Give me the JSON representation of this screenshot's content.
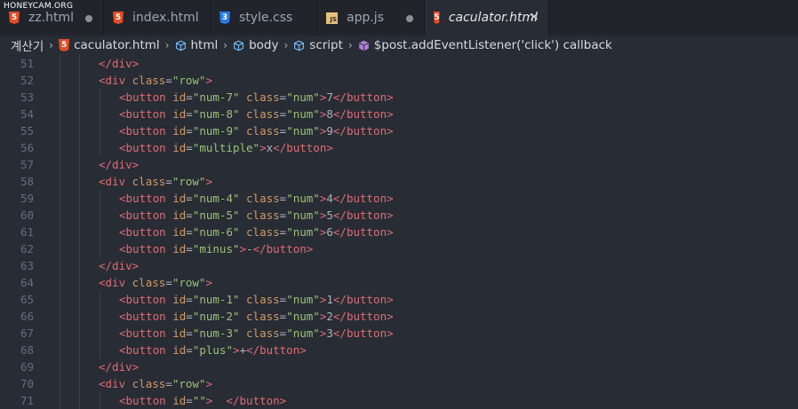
{
  "watermark": "HONEYCAM.ORG",
  "tabs": [
    {
      "label": "zz.html",
      "icon": "html-file-icon",
      "state": "modified"
    },
    {
      "label": "index.html",
      "icon": "html-file-icon",
      "state": "normal"
    },
    {
      "label": "style.css",
      "icon": "css-file-icon",
      "state": "normal"
    },
    {
      "label": "app.js",
      "icon": "js-file-icon",
      "state": "modified"
    },
    {
      "label": "caculator.html",
      "icon": "html-file-icon",
      "state": "active",
      "close": "×"
    }
  ],
  "breadcrumb": {
    "root": "계산기",
    "file": "caculator.html",
    "items": [
      "html",
      "body",
      "script",
      "$post.addEventListener('click') callback"
    ],
    "separator": "›"
  },
  "colors": {
    "background": "#282c34",
    "tabbar": "#21252b",
    "tag": "#e06c75",
    "attribute": "#d19a66",
    "string": "#98c379",
    "text": "#abb2bf",
    "line_number": "#636d83"
  },
  "lines": [
    {
      "n": "51",
      "indent": 1,
      "tokens": [
        [
          "tag",
          "</div>"
        ]
      ]
    },
    {
      "n": "52",
      "indent": 1,
      "tokens": [
        [
          "tag",
          "<div"
        ],
        [
          "txt",
          " "
        ],
        [
          "attr",
          "class"
        ],
        [
          "pun",
          "="
        ],
        [
          "str",
          "\"row\""
        ],
        [
          "tag",
          ">"
        ]
      ]
    },
    {
      "n": "53",
      "indent": 2,
      "tokens": [
        [
          "tag",
          "<button"
        ],
        [
          "txt",
          " "
        ],
        [
          "attr",
          "id"
        ],
        [
          "pun",
          "="
        ],
        [
          "str",
          "\"num-7\""
        ],
        [
          "txt",
          " "
        ],
        [
          "attr",
          "class"
        ],
        [
          "pun",
          "="
        ],
        [
          "str",
          "\"num\""
        ],
        [
          "tag",
          ">"
        ],
        [
          "txt",
          "7"
        ],
        [
          "tag",
          "</button>"
        ]
      ]
    },
    {
      "n": "54",
      "indent": 2,
      "tokens": [
        [
          "tag",
          "<button"
        ],
        [
          "txt",
          " "
        ],
        [
          "attr",
          "id"
        ],
        [
          "pun",
          "="
        ],
        [
          "str",
          "\"num-8\""
        ],
        [
          "txt",
          " "
        ],
        [
          "attr",
          "class"
        ],
        [
          "pun",
          "="
        ],
        [
          "str",
          "\"num\""
        ],
        [
          "tag",
          ">"
        ],
        [
          "txt",
          "8"
        ],
        [
          "tag",
          "</button>"
        ]
      ]
    },
    {
      "n": "55",
      "indent": 2,
      "tokens": [
        [
          "tag",
          "<button"
        ],
        [
          "txt",
          " "
        ],
        [
          "attr",
          "id"
        ],
        [
          "pun",
          "="
        ],
        [
          "str",
          "\"num-9\""
        ],
        [
          "txt",
          " "
        ],
        [
          "attr",
          "class"
        ],
        [
          "pun",
          "="
        ],
        [
          "str",
          "\"num\""
        ],
        [
          "tag",
          ">"
        ],
        [
          "txt",
          "9"
        ],
        [
          "tag",
          "</button>"
        ]
      ]
    },
    {
      "n": "56",
      "indent": 2,
      "tokens": [
        [
          "tag",
          "<button"
        ],
        [
          "txt",
          " "
        ],
        [
          "attr",
          "id"
        ],
        [
          "pun",
          "="
        ],
        [
          "str",
          "\"multiple\""
        ],
        [
          "tag",
          ">"
        ],
        [
          "txt",
          "x"
        ],
        [
          "tag",
          "</button>"
        ]
      ]
    },
    {
      "n": "57",
      "indent": 1,
      "tokens": [
        [
          "tag",
          "</div>"
        ]
      ]
    },
    {
      "n": "58",
      "indent": 1,
      "tokens": [
        [
          "tag",
          "<div"
        ],
        [
          "txt",
          " "
        ],
        [
          "attr",
          "class"
        ],
        [
          "pun",
          "="
        ],
        [
          "str",
          "\"row\""
        ],
        [
          "tag",
          ">"
        ]
      ]
    },
    {
      "n": "59",
      "indent": 2,
      "tokens": [
        [
          "tag",
          "<button"
        ],
        [
          "txt",
          " "
        ],
        [
          "attr",
          "id"
        ],
        [
          "pun",
          "="
        ],
        [
          "str",
          "\"num-4\""
        ],
        [
          "txt",
          " "
        ],
        [
          "attr",
          "class"
        ],
        [
          "pun",
          "="
        ],
        [
          "str",
          "\"num\""
        ],
        [
          "tag",
          ">"
        ],
        [
          "txt",
          "4"
        ],
        [
          "tag",
          "</button>"
        ]
      ]
    },
    {
      "n": "60",
      "indent": 2,
      "tokens": [
        [
          "tag",
          "<button"
        ],
        [
          "txt",
          " "
        ],
        [
          "attr",
          "id"
        ],
        [
          "pun",
          "="
        ],
        [
          "str",
          "\"num-5\""
        ],
        [
          "txt",
          " "
        ],
        [
          "attr",
          "class"
        ],
        [
          "pun",
          "="
        ],
        [
          "str",
          "\"num\""
        ],
        [
          "tag",
          ">"
        ],
        [
          "txt",
          "5"
        ],
        [
          "tag",
          "</button>"
        ]
      ]
    },
    {
      "n": "61",
      "indent": 2,
      "tokens": [
        [
          "tag",
          "<button"
        ],
        [
          "txt",
          " "
        ],
        [
          "attr",
          "id"
        ],
        [
          "pun",
          "="
        ],
        [
          "str",
          "\"num-6\""
        ],
        [
          "txt",
          " "
        ],
        [
          "attr",
          "class"
        ],
        [
          "pun",
          "="
        ],
        [
          "str",
          "\"num\""
        ],
        [
          "tag",
          ">"
        ],
        [
          "txt",
          "6"
        ],
        [
          "tag",
          "</button>"
        ]
      ]
    },
    {
      "n": "62",
      "indent": 2,
      "tokens": [
        [
          "tag",
          "<button"
        ],
        [
          "txt",
          " "
        ],
        [
          "attr",
          "id"
        ],
        [
          "pun",
          "="
        ],
        [
          "str",
          "\"minus\""
        ],
        [
          "tag",
          ">"
        ],
        [
          "txt",
          "-"
        ],
        [
          "tag",
          "</button>"
        ]
      ]
    },
    {
      "n": "63",
      "indent": 1,
      "tokens": [
        [
          "tag",
          "</div>"
        ]
      ]
    },
    {
      "n": "64",
      "indent": 1,
      "tokens": [
        [
          "tag",
          "<div"
        ],
        [
          "txt",
          " "
        ],
        [
          "attr",
          "class"
        ],
        [
          "pun",
          "="
        ],
        [
          "str",
          "\"row\""
        ],
        [
          "tag",
          ">"
        ]
      ]
    },
    {
      "n": "65",
      "indent": 2,
      "tokens": [
        [
          "tag",
          "<button"
        ],
        [
          "txt",
          " "
        ],
        [
          "attr",
          "id"
        ],
        [
          "pun",
          "="
        ],
        [
          "str",
          "\"num-1\""
        ],
        [
          "txt",
          " "
        ],
        [
          "attr",
          "class"
        ],
        [
          "pun",
          "="
        ],
        [
          "str",
          "\"num\""
        ],
        [
          "tag",
          ">"
        ],
        [
          "txt",
          "1"
        ],
        [
          "tag",
          "</button>"
        ]
      ]
    },
    {
      "n": "66",
      "indent": 2,
      "tokens": [
        [
          "tag",
          "<button"
        ],
        [
          "txt",
          " "
        ],
        [
          "attr",
          "id"
        ],
        [
          "pun",
          "="
        ],
        [
          "str",
          "\"num-2\""
        ],
        [
          "txt",
          " "
        ],
        [
          "attr",
          "class"
        ],
        [
          "pun",
          "="
        ],
        [
          "str",
          "\"num\""
        ],
        [
          "tag",
          ">"
        ],
        [
          "txt",
          "2"
        ],
        [
          "tag",
          "</button>"
        ]
      ]
    },
    {
      "n": "67",
      "indent": 2,
      "tokens": [
        [
          "tag",
          "<button"
        ],
        [
          "txt",
          " "
        ],
        [
          "attr",
          "id"
        ],
        [
          "pun",
          "="
        ],
        [
          "str",
          "\"num-3\""
        ],
        [
          "txt",
          " "
        ],
        [
          "attr",
          "class"
        ],
        [
          "pun",
          "="
        ],
        [
          "str",
          "\"num\""
        ],
        [
          "tag",
          ">"
        ],
        [
          "txt",
          "3"
        ],
        [
          "tag",
          "</button>"
        ]
      ]
    },
    {
      "n": "68",
      "indent": 2,
      "tokens": [
        [
          "tag",
          "<button"
        ],
        [
          "txt",
          " "
        ],
        [
          "attr",
          "id"
        ],
        [
          "pun",
          "="
        ],
        [
          "str",
          "\"plus\""
        ],
        [
          "tag",
          ">"
        ],
        [
          "txt",
          "+"
        ],
        [
          "tag",
          "</button>"
        ]
      ]
    },
    {
      "n": "69",
      "indent": 1,
      "tokens": [
        [
          "tag",
          "</div>"
        ]
      ]
    },
    {
      "n": "70",
      "indent": 1,
      "tokens": [
        [
          "tag",
          "<div"
        ],
        [
          "txt",
          " "
        ],
        [
          "attr",
          "class"
        ],
        [
          "pun",
          "="
        ],
        [
          "str",
          "\"row\""
        ],
        [
          "tag",
          ">"
        ]
      ]
    },
    {
      "n": "71",
      "indent": 2,
      "tokens": [
        [
          "tag",
          "<button"
        ],
        [
          "txt",
          " "
        ],
        [
          "attr",
          "id"
        ],
        [
          "pun",
          "="
        ],
        [
          "str",
          "\"\""
        ],
        [
          "tag",
          ">"
        ],
        [
          "txt",
          "  "
        ],
        [
          "tag",
          "</button>"
        ]
      ]
    }
  ]
}
